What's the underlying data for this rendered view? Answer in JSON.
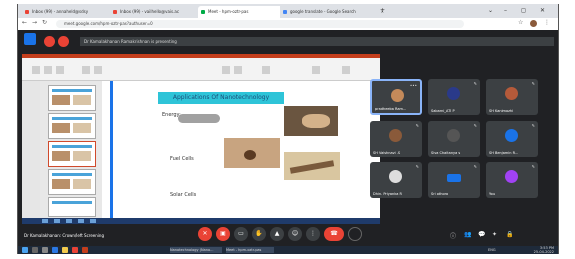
{
  "browser": {
    "tabs": [
      {
        "label": "Inbox (99) - annaheld@sdsy",
        "color": "#ea4335"
      },
      {
        "label": "Inbox (99) - vailhello@vais.ac",
        "color": "#ea4335"
      },
      {
        "label": "Meet - hpm-oztr-pas",
        "color": "#00ac47",
        "active": true
      },
      {
        "label": "google translate - Google Search",
        "color": "#4285f4"
      }
    ],
    "new_tab": "+",
    "window_controls": [
      "⌄",
      "–",
      "◻",
      "✕"
    ],
    "url": "meet.google.com/hpm-oztr-pas?authuser=0",
    "back": "←",
    "forward": "→",
    "reload": "↻"
  },
  "meet": {
    "presenting_text": "Dr Kamalakhanan Ramakrishnan is presenting",
    "presenter_label": "Dr Kamalakhanan: Crown/left Screening",
    "slide": {
      "title": "Applications Of Nanotechnology",
      "items": [
        "Energy:",
        "Fuel Cells",
        "Solar Cells"
      ]
    },
    "participants": [
      {
        "name": "pradheeba Ram...",
        "avatar_color": "#c48a5a",
        "active": true
      },
      {
        "name": "Sabarni_ATI P",
        "avatar_color": "#2a3a8a"
      },
      {
        "name": "SH Kanimozhi",
        "avatar_color": "#b55a3a"
      },
      {
        "name": "SH Vaishnavi .S",
        "avatar_color": "#8a5a3a"
      },
      {
        "name": "Siva Chaitanya s",
        "avatar_color": "#555555"
      },
      {
        "name": "SH Benjamin R...",
        "avatar_color": "#1a73e8"
      },
      {
        "name": "Dhin. Priyanka R",
        "avatar_color": "#dddddd"
      },
      {
        "name": "Sri othoro",
        "avatar_color": "#1a73e8"
      },
      {
        "name": "You",
        "avatar_color": "#a142f4"
      }
    ],
    "controls": {
      "icons": [
        "mic-off-icon",
        "camera-off-icon",
        "captions-icon",
        "raise-hand-icon",
        "present-icon",
        "more-icon"
      ],
      "hang_up_color": "#ea4335"
    }
  },
  "taskbar": {
    "items": [
      "Nanotechnology (Nano...",
      "Meet - hpm-oztr-pas"
    ],
    "time": "3:53 PM",
    "date": "25-04-2022",
    "lang": "ENG"
  }
}
